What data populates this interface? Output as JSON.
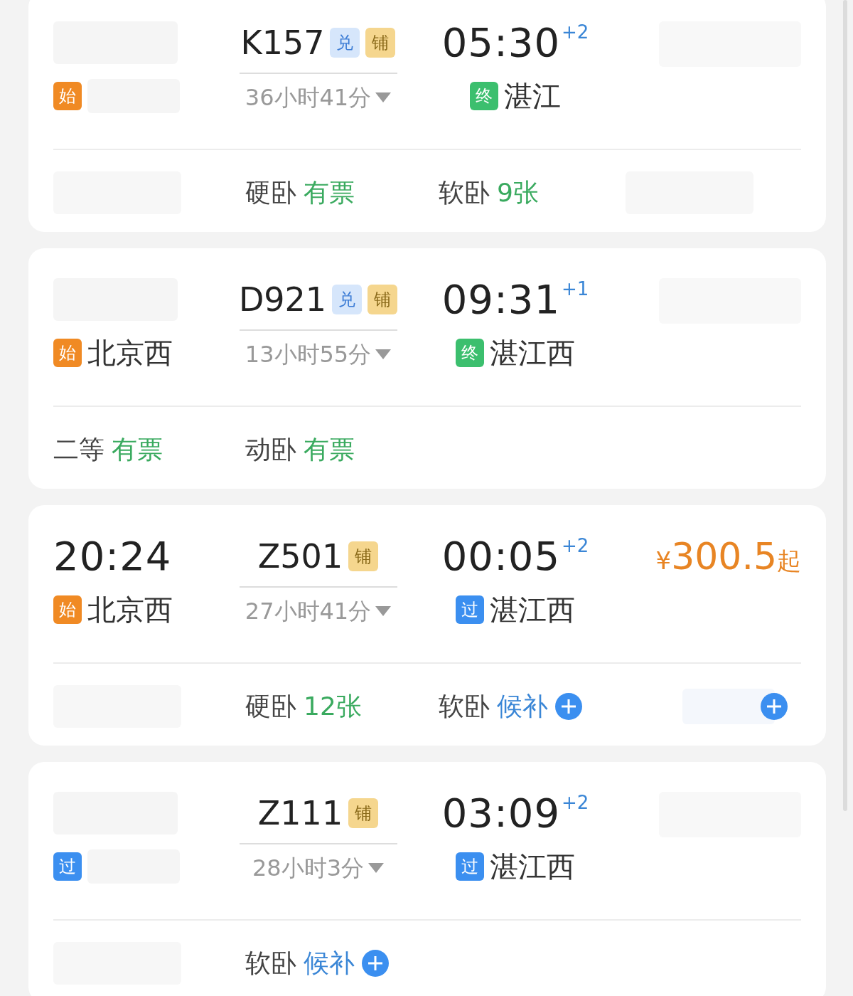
{
  "trains": [
    {
      "depart": {
        "tag": {
          "text": "始",
          "kind": "start"
        }
      },
      "train": {
        "number": "K157",
        "badges": [
          {
            "text": "兑",
            "kind": "exchange"
          },
          {
            "text": "铺",
            "kind": "berth"
          }
        ],
        "duration": "36小时41分"
      },
      "arrive": {
        "time": "05:30",
        "day_offset": "+2",
        "tag": {
          "text": "终",
          "kind": "end"
        },
        "station": "湛江"
      },
      "price": {
        "kind": "obscured"
      },
      "seats": [
        {
          "kind": "obscured"
        },
        {
          "kind": "seat",
          "class": "硬卧",
          "status": "有票",
          "waitlist": false
        },
        {
          "kind": "seat",
          "class": "软卧",
          "status": "9张",
          "waitlist": false
        },
        {
          "kind": "obscured"
        }
      ]
    },
    {
      "depart": {
        "station": "北京西",
        "tag": {
          "text": "始",
          "kind": "start"
        }
      },
      "train": {
        "number": "D921",
        "badges": [
          {
            "text": "兑",
            "kind": "exchange"
          },
          {
            "text": "铺",
            "kind": "berth"
          }
        ],
        "duration": "13小时55分"
      },
      "arrive": {
        "time": "09:31",
        "day_offset": "+1",
        "tag": {
          "text": "终",
          "kind": "end"
        },
        "station": "湛江西"
      },
      "price": {
        "kind": "obscured"
      },
      "seats": [
        {
          "kind": "seat",
          "class": "二等",
          "status": "有票",
          "waitlist": false
        },
        {
          "kind": "seat",
          "class": "动卧",
          "status": "有票",
          "waitlist": false
        }
      ]
    },
    {
      "depart": {
        "time": "20:24",
        "station": "北京西",
        "tag": {
          "text": "始",
          "kind": "start"
        }
      },
      "train": {
        "number": "Z501",
        "badges": [
          {
            "text": "铺",
            "kind": "berth"
          }
        ],
        "duration": "27小时41分"
      },
      "arrive": {
        "time": "00:05",
        "day_offset": "+2",
        "tag": {
          "text": "过",
          "kind": "pass"
        },
        "station": "湛江西"
      },
      "price": {
        "kind": "price",
        "currency": "¥",
        "amount": "300.5",
        "suffix": "起"
      },
      "seats": [
        {
          "kind": "obscured"
        },
        {
          "kind": "seat",
          "class": "硬卧",
          "status": "12张",
          "waitlist": false
        },
        {
          "kind": "seat",
          "class": "软卧",
          "status": "候补",
          "waitlist": true
        },
        {
          "kind": "obscured_waitlist"
        }
      ]
    },
    {
      "depart": {
        "tag": {
          "text": "过",
          "kind": "pass"
        }
      },
      "train": {
        "number": "Z111",
        "badges": [
          {
            "text": "铺",
            "kind": "berth"
          }
        ],
        "duration": "28小时3分"
      },
      "arrive": {
        "time": "03:09",
        "day_offset": "+2",
        "tag": {
          "text": "过",
          "kind": "pass"
        },
        "station": "湛江西"
      },
      "price": {
        "kind": "obscured"
      },
      "seats": [
        {
          "kind": "obscured"
        },
        {
          "kind": "seat",
          "class": "软卧",
          "status": "候补",
          "waitlist": true
        }
      ]
    }
  ]
}
